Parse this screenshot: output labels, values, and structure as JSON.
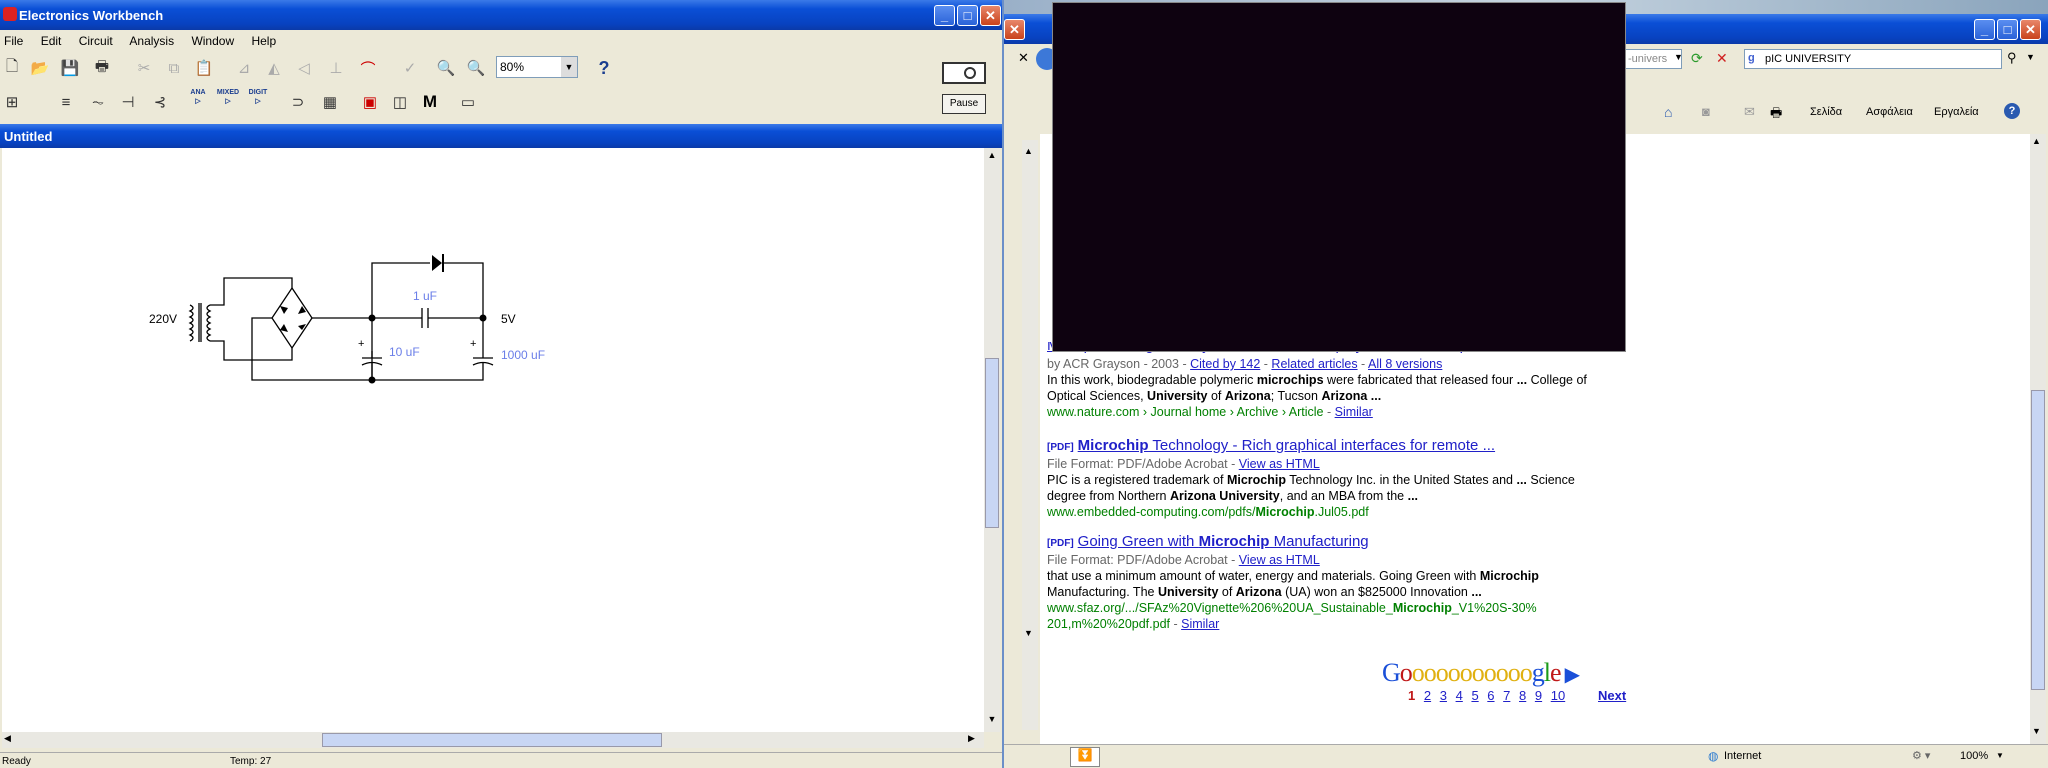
{
  "ewb": {
    "title": "Electronics Workbench",
    "menu": [
      "File",
      "Edit",
      "Circuit",
      "Analysis",
      "Window",
      "Help"
    ],
    "zoom": "80%",
    "help_btn": "?",
    "pause": "Pause",
    "doc_title": "Untitled",
    "comp_labels": [
      "ANA",
      "MIXED",
      "DIGIT"
    ],
    "m_label": "M",
    "circuit": {
      "v_in": "220V",
      "v_out": "5V",
      "c1": "1 uF",
      "c2": "10 uF",
      "c3": "1000 uF",
      "plus": "+"
    },
    "status_left": "Ready",
    "status_temp": "Temp: 27"
  },
  "ie": {
    "search_value": "pIC UNIVERSITY",
    "addr_fragment": "-univers",
    "toolbar": [
      "Σελίδα",
      "Ασφάλεια",
      "Εργαλεία"
    ],
    "results": [
      {
        "title_html": "Multi-pulse drug delivery from a resorbable polymeric microchip ...",
        "meta_prefix": "by ACR Grayson - 2003 - ",
        "cited": "Cited by 142",
        "related": "Related articles",
        "versions": "All 8 versions",
        "snip1_a": "In this work, biodegradable polymeric ",
        "snip1_b": "microchips",
        "snip1_c": " were fabricated that released four ",
        "snip1_d": "...",
        "snip1_e": " College of",
        "snip2_a": "Optical Sciences, ",
        "snip2_b": "University",
        "snip2_c": " of ",
        "snip2_d": "Arizona",
        "snip2_e": "; Tucson ",
        "snip2_f": "Arizona",
        "snip2_g": " ...",
        "url": "www.nature.com › Journal home › Archive › Article",
        "sep": " - ",
        "similar": "Similar"
      },
      {
        "pdf": "[PDF]",
        "title_b": "Microchip",
        "title_rest": " Technology - Rich graphical interfaces for remote ...",
        "ff": "File Format: PDF/Adobe Acrobat - ",
        "view": "View as HTML",
        "l1_a": "PIC is a registered trademark of ",
        "l1_b": "Microchip",
        "l1_c": " Technology Inc. in the United States and ",
        "l1_d": "...",
        "l1_e": " Science",
        "l2_a": "degree from Northern ",
        "l2_b": "Arizona University",
        "l2_c": ", and an MBA from the ",
        "l2_d": "...",
        "url_a": "www.embedded-computing.com/pdfs/",
        "url_b": "Microchip",
        "url_c": ".Jul05.pdf"
      },
      {
        "pdf": "[PDF]",
        "title_a": "Going Green with ",
        "title_b": "Microchip",
        "title_c": " Manufacturing",
        "ff": "File Format: PDF/Adobe Acrobat - ",
        "view": "View as HTML",
        "l1_a": "that use a minimum amount of water, energy and materials. Going Green with ",
        "l1_b": "Microchip",
        "l2_a": "Manufacturing. The ",
        "l2_b": "University",
        "l2_c": " of ",
        "l2_d": "Arizona",
        "l2_e": " (UA) won an $825000 Innovation ",
        "l2_f": "...",
        "url1_a": "www.sfaz.org/.../SFAz%20Vignette%206%20UA_Sustainable_",
        "url1_b": "Microchip",
        "url1_c": "_V1%20S-30%",
        "url2": "201,m%20%20pdf.pdf",
        "sep": " - ",
        "similar": "Similar"
      }
    ],
    "google": {
      "letters": [
        "G",
        "o",
        "o",
        "o",
        "o",
        "o",
        "o",
        "o",
        "o",
        "o",
        "o",
        "o",
        "g",
        "l",
        "e"
      ],
      "pages": [
        "1",
        "2",
        "3",
        "4",
        "5",
        "6",
        "7",
        "8",
        "9",
        "10"
      ],
      "next": "Next"
    },
    "status_zone": "Internet",
    "zoom": "100%"
  },
  "colors": {
    "ewb_label": "#6a7ee8",
    "video": "#0e0210",
    "link": "#2020c8",
    "green": "#008000"
  }
}
